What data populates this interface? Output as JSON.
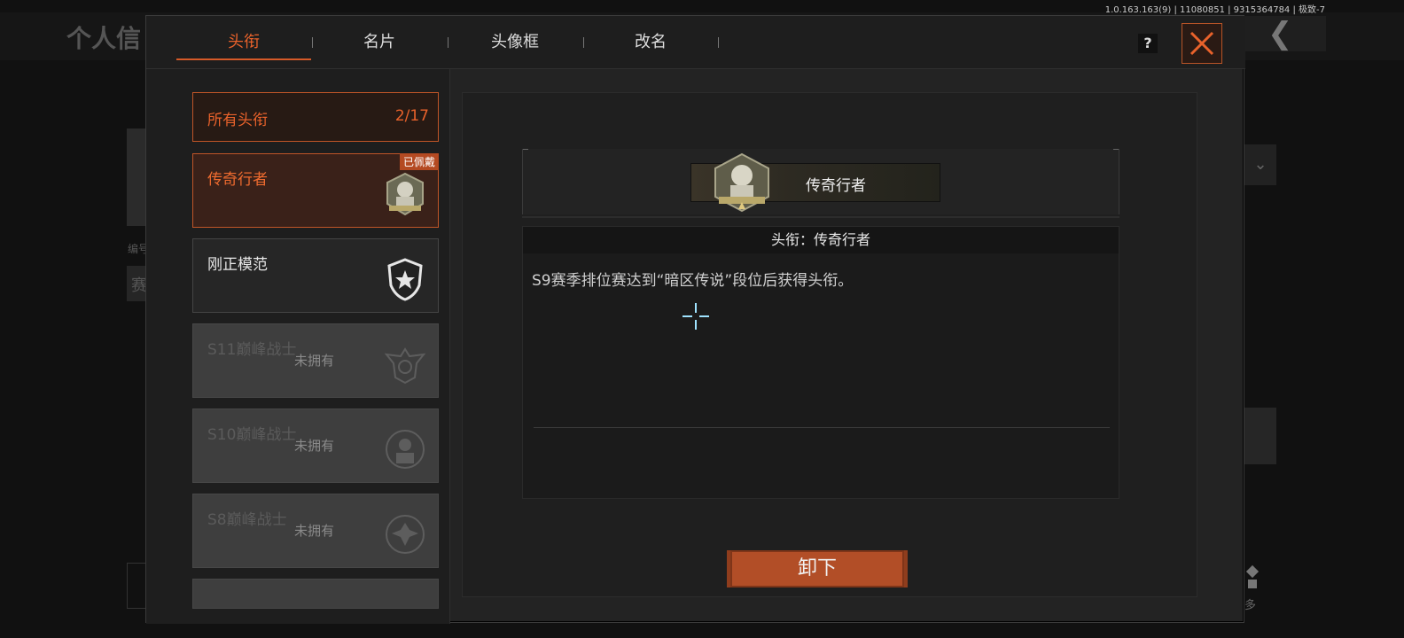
{
  "background": {
    "title": "个人信",
    "back_glyph": "❮",
    "left_text_1": "编号",
    "left_text_2": "赛",
    "right_more": "多"
  },
  "version_info": "1.0.163.163(9) | 11080851 | 9315364784 | 极致-7",
  "tabs": [
    {
      "label": "头衔",
      "active": true
    },
    {
      "label": "名片",
      "active": false
    },
    {
      "label": "头像框",
      "active": false
    },
    {
      "label": "改名",
      "active": false
    }
  ],
  "help_label": "?",
  "all_titles": {
    "label": "所有头衔",
    "count": "2/17"
  },
  "title_items": [
    {
      "name": "传奇行者",
      "tag": "已佩戴",
      "icon": "legend-soldier-badge-icon",
      "state": "selected"
    },
    {
      "name": "刚正模范",
      "icon": "star-shield-icon",
      "state": "owned"
    },
    {
      "name": "S11巅峰战士",
      "status": "未拥有",
      "icon": "winged-shield-icon",
      "state": "locked"
    },
    {
      "name": "S10巅峰战士",
      "status": "未拥有",
      "icon": "soldier-portrait-icon",
      "state": "locked"
    },
    {
      "name": "S8巅峰战士",
      "status": "未拥有",
      "icon": "eagle-emblem-icon",
      "state": "locked"
    }
  ],
  "detail": {
    "banner_name": "传奇行者",
    "header": "头衔：传奇行者",
    "description": "S9赛季排位赛达到“暗区传说”段位后获得头衔。",
    "action_label": "卸下"
  },
  "colors": {
    "accent": "#e9622b",
    "button": "#b24e27",
    "panel": "#232323"
  }
}
